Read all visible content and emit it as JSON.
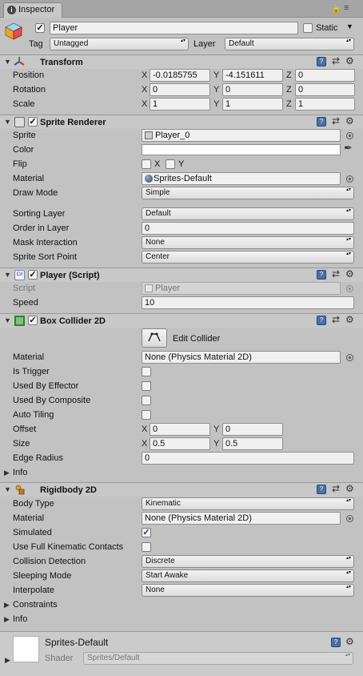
{
  "window": {
    "tab_title": "Inspector"
  },
  "object": {
    "name": "Player",
    "static_label": "Static",
    "tag_label": "Tag",
    "tag_value": "Untagged",
    "layer_label": "Layer",
    "layer_value": "Default"
  },
  "transform": {
    "title": "Transform",
    "position_label": "Position",
    "rotation_label": "Rotation",
    "scale_label": "Scale",
    "axis": {
      "x": "X",
      "y": "Y",
      "z": "Z"
    },
    "position": {
      "x": "-0.0185755",
      "y": "-4.151611",
      "z": "0"
    },
    "rotation": {
      "x": "0",
      "y": "0",
      "z": "0"
    },
    "scale": {
      "x": "1",
      "y": "1",
      "z": "1"
    }
  },
  "sprite_renderer": {
    "title": "Sprite Renderer",
    "sprite_label": "Sprite",
    "sprite_value": "Player_0",
    "color_label": "Color",
    "flip_label": "Flip",
    "flip_x": "X",
    "flip_y": "Y",
    "material_label": "Material",
    "material_value": "Sprites-Default",
    "draw_mode_label": "Draw Mode",
    "draw_mode_value": "Simple",
    "sorting_layer_label": "Sorting Layer",
    "sorting_layer_value": "Default",
    "order_label": "Order in Layer",
    "order_value": "0",
    "mask_label": "Mask Interaction",
    "mask_value": "None",
    "sort_point_label": "Sprite Sort Point",
    "sort_point_value": "Center"
  },
  "player_script": {
    "title": "Player (Script)",
    "script_label": "Script",
    "script_value": "Player",
    "speed_label": "Speed",
    "speed_value": "10"
  },
  "box_collider": {
    "title": "Box Collider 2D",
    "edit_label": "Edit Collider",
    "material_label": "Material",
    "material_value": "None (Physics Material 2D)",
    "is_trigger_label": "Is Trigger",
    "effector_label": "Used By Effector",
    "composite_label": "Used By Composite",
    "auto_tiling_label": "Auto Tiling",
    "offset_label": "Offset",
    "offset_x": "0",
    "offset_y": "0",
    "size_label": "Size",
    "size_x": "0.5",
    "size_y": "0.5",
    "edge_radius_label": "Edge Radius",
    "edge_radius_value": "0",
    "info_label": "Info",
    "axis": {
      "x": "X",
      "y": "Y"
    }
  },
  "rigidbody": {
    "title": "Rigidbody 2D",
    "body_type_label": "Body Type",
    "body_type_value": "Kinematic",
    "material_label": "Material",
    "material_value": "None (Physics Material 2D)",
    "simulated_label": "Simulated",
    "simulated_checked": true,
    "full_kinematic_label": "Use Full Kinematic Contacts",
    "collision_label": "Collision Detection",
    "collision_value": "Discrete",
    "sleeping_label": "Sleeping Mode",
    "sleeping_value": "Start Awake",
    "interpolate_label": "Interpolate",
    "interpolate_value": "None",
    "constraints_label": "Constraints",
    "info_label": "Info"
  },
  "material_footer": {
    "name": "Sprites-Default",
    "shader_label": "Shader",
    "shader_value": "Sprites/Default"
  },
  "colors": {
    "background": "#c2c2c2",
    "header": "#c8c8c8",
    "check_blue": "#1a3a8a"
  }
}
